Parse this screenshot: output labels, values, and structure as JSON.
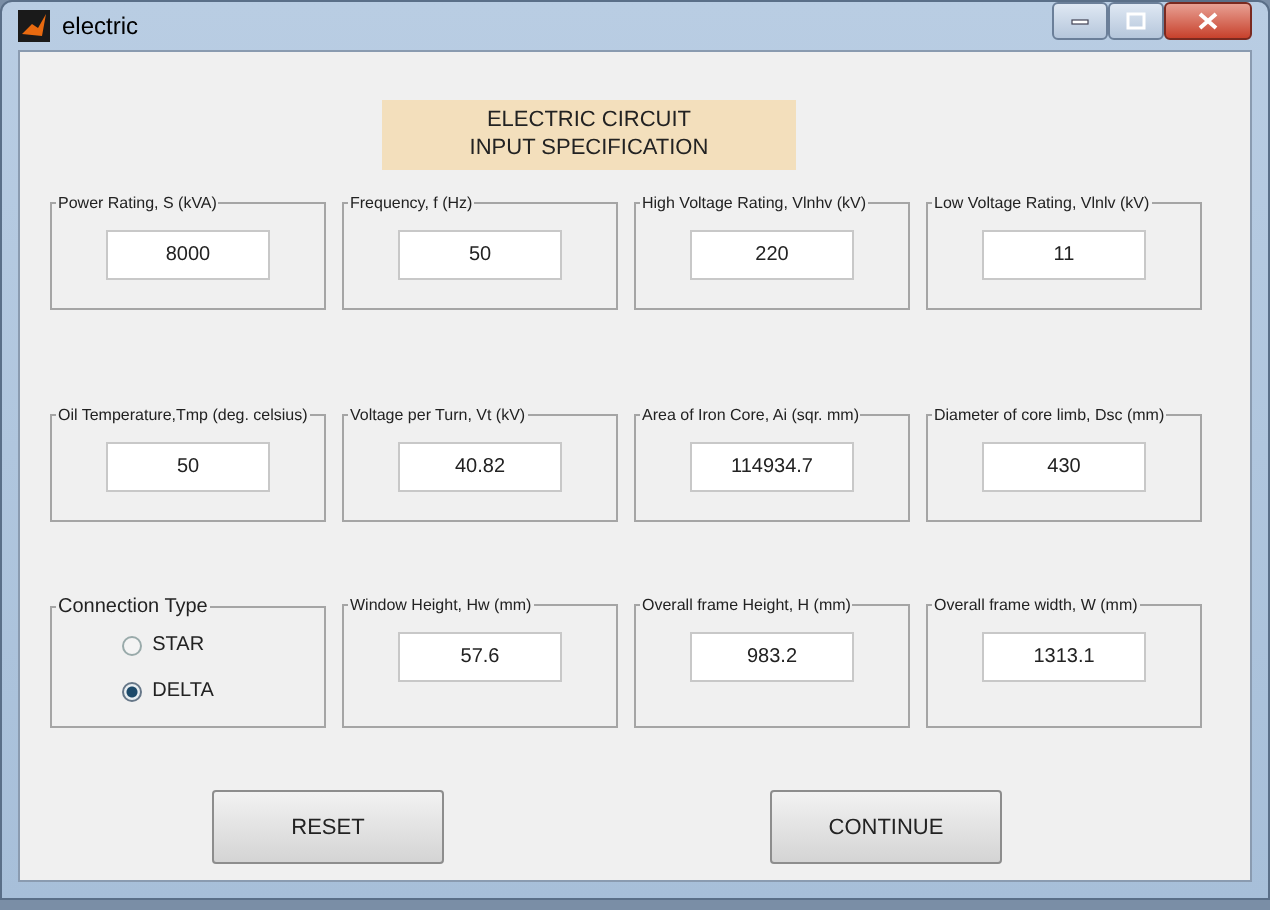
{
  "window": {
    "title": "electric"
  },
  "heading": [
    "ELECTRIC CIRCUIT",
    "INPUT SPECIFICATION"
  ],
  "rows": [
    [
      {
        "kind": "field",
        "label": "Power Rating, S (kVA)",
        "value": "8000"
      },
      {
        "kind": "field",
        "label": "Frequency, f (Hz)",
        "value": "50"
      },
      {
        "kind": "field",
        "label": "High Voltage Rating, Vlnhv (kV)",
        "value": "220"
      },
      {
        "kind": "field",
        "label": "Low Voltage Rating, Vlnlv (kV)",
        "value": "11"
      }
    ],
    [
      {
        "kind": "field",
        "label": "Oil Temperature,Tmp (deg. celsius)",
        "value": "50"
      },
      {
        "kind": "field",
        "label": "Voltage per Turn, Vt (kV)",
        "value": "40.82"
      },
      {
        "kind": "field",
        "label": "Area of Iron Core, Ai (sqr. mm)",
        "value": "114934.7"
      },
      {
        "kind": "field",
        "label": "Diameter of core limb, Dsc (mm)",
        "value": "430"
      }
    ],
    [
      {
        "kind": "radio_group",
        "label": "Connection Type",
        "options": [
          {
            "label": "STAR",
            "selected": false
          },
          {
            "label": "DELTA",
            "selected": true
          }
        ]
      },
      {
        "kind": "field",
        "label": "Window Height, Hw (mm)",
        "value": "57.6"
      },
      {
        "kind": "field",
        "label": "Overall frame Height, H (mm)",
        "value": "983.2"
      },
      {
        "kind": "field",
        "label": "Overall frame width, W (mm)",
        "value": "1313.1"
      }
    ]
  ],
  "buttons": [
    "RESET",
    "CONTINUE"
  ]
}
